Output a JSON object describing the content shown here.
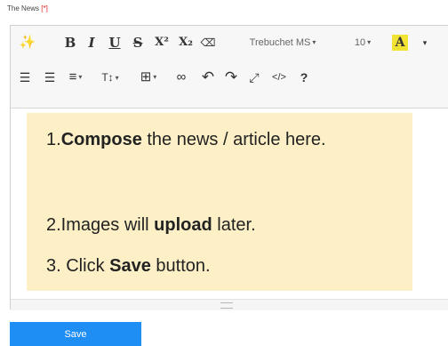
{
  "field": {
    "label": "The News",
    "required_mark": "[*]"
  },
  "toolbar": {
    "row1": [
      {
        "name": "magic-wand-icon",
        "glyph": "✨"
      },
      {
        "name": "bold-button",
        "glyph": "B"
      },
      {
        "name": "italic-button",
        "glyph": "I"
      },
      {
        "name": "underline-button",
        "glyph": "U"
      },
      {
        "name": "strikethrough-button",
        "glyph": "S"
      },
      {
        "name": "superscript-button",
        "glyph": "X²"
      },
      {
        "name": "subscript-button",
        "glyph": "X₂"
      },
      {
        "name": "eraser-icon",
        "glyph": "⌫"
      }
    ],
    "font_name": "Trebuchet MS",
    "font_size": "10",
    "highlight_letter": "A",
    "row2": [
      {
        "name": "unordered-list-icon",
        "glyph": "☰"
      },
      {
        "name": "ordered-list-icon",
        "glyph": "☰"
      },
      {
        "name": "align-dropdown-icon",
        "glyph": "≡"
      },
      {
        "name": "text-height-icon",
        "glyph": "T↕"
      },
      {
        "name": "table-icon",
        "glyph": "⊞"
      },
      {
        "name": "link-icon",
        "glyph": "∞"
      },
      {
        "name": "undo-icon",
        "glyph": "↶"
      },
      {
        "name": "redo-icon",
        "glyph": "↷"
      },
      {
        "name": "fullscreen-icon",
        "glyph": "⤢"
      },
      {
        "name": "code-view-icon",
        "glyph": "</>"
      },
      {
        "name": "help-icon",
        "glyph": "?"
      }
    ]
  },
  "content": {
    "line1_prefix": "1.",
    "line1_bold": "Compose",
    "line1_suffix": " the news / article here.",
    "line2_prefix": "2.Images will ",
    "line2_bold": "upload",
    "line2_suffix": " later.",
    "line3_prefix": "3. Click ",
    "line3_bold": "Save",
    "line3_suffix": " button."
  },
  "save_label": "Save"
}
